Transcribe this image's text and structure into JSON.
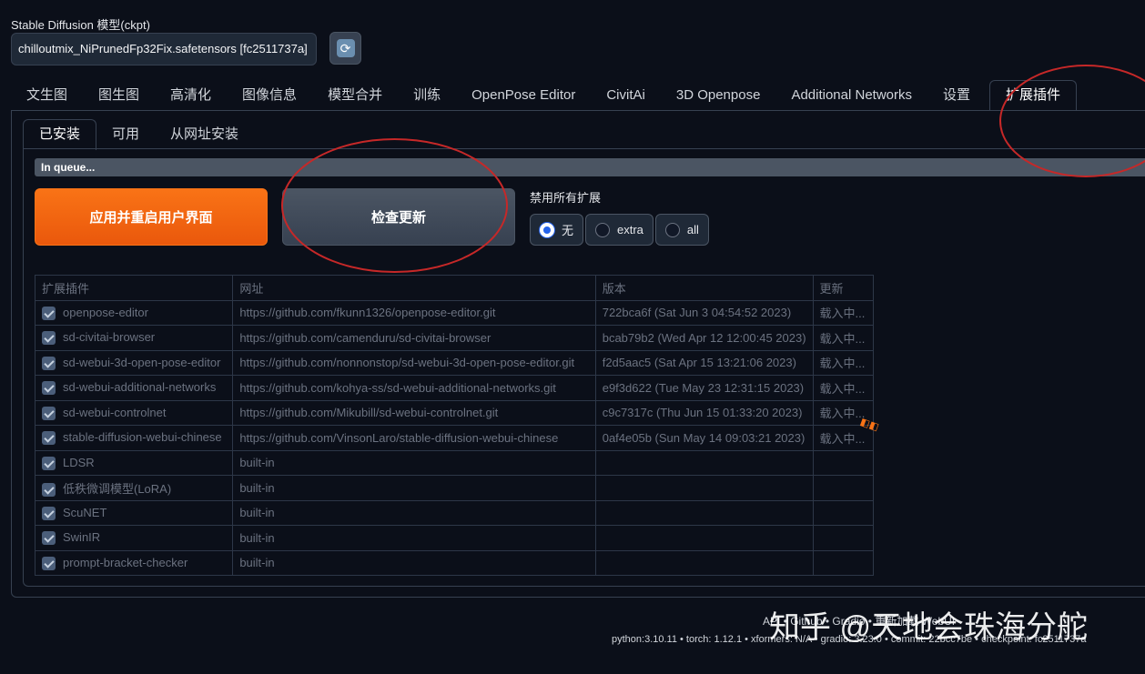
{
  "checkpoint": {
    "label": "Stable Diffusion 模型(ckpt)",
    "value": "chilloutmix_NiPrunedFp32Fix.safetensors [fc2511737a]"
  },
  "main_tabs": [
    "文生图",
    "图生图",
    "高清化",
    "图像信息",
    "模型合并",
    "训练",
    "OpenPose Editor",
    "CivitAi",
    "3D Openpose",
    "Additional Networks",
    "设置",
    "扩展插件"
  ],
  "sub_tabs": [
    "已安装",
    "可用",
    "从网址安装"
  ],
  "queue_text": "In queue...",
  "apply_button": "应用并重启用户界面",
  "check_button": "检查更新",
  "disable_label": "禁用所有扩展",
  "disable_options": [
    "无",
    "extra",
    "all"
  ],
  "table": {
    "headers": [
      "扩展插件",
      "网址",
      "版本",
      "更新"
    ],
    "rows": [
      {
        "name": "openpose-editor",
        "url": "https://github.com/fkunn1326/openpose-editor.git",
        "version": "722bca6f (Sat Jun 3 04:54:52 2023)",
        "update": "载入中..."
      },
      {
        "name": "sd-civitai-browser",
        "url": "https://github.com/camenduru/sd-civitai-browser",
        "version": "bcab79b2 (Wed Apr 12 12:00:45 2023)",
        "update": "载入中..."
      },
      {
        "name": "sd-webui-3d-open-pose-editor",
        "url": "https://github.com/nonnonstop/sd-webui-3d-open-pose-editor.git",
        "version": "f2d5aac5 (Sat Apr 15 13:21:06 2023)",
        "update": "载入中..."
      },
      {
        "name": "sd-webui-additional-networks",
        "url": "https://github.com/kohya-ss/sd-webui-additional-networks.git",
        "version": "e9f3d622 (Tue May 23 12:31:15 2023)",
        "update": "载入中..."
      },
      {
        "name": "sd-webui-controlnet",
        "url": "https://github.com/Mikubill/sd-webui-controlnet.git",
        "version": "c9c7317c (Thu Jun 15 01:33:20 2023)",
        "update": "载入中..."
      },
      {
        "name": "stable-diffusion-webui-chinese",
        "url": "https://github.com/VinsonLaro/stable-diffusion-webui-chinese",
        "version": "0af4e05b (Sun May 14 09:03:21 2023)",
        "update": "载入中..."
      },
      {
        "name": "LDSR",
        "url": "built-in",
        "version": "",
        "update": ""
      },
      {
        "name": "低秩微调模型(LoRA)",
        "url": "built-in",
        "version": "",
        "update": ""
      },
      {
        "name": "ScuNET",
        "url": "built-in",
        "version": "",
        "update": ""
      },
      {
        "name": "SwinIR",
        "url": "built-in",
        "version": "",
        "update": ""
      },
      {
        "name": "prompt-bracket-checker",
        "url": "built-in",
        "version": "",
        "update": ""
      }
    ]
  },
  "footer": {
    "links": "API  •  Github  •  Gradio  •  重新加载 WebUI",
    "info": "python:3.10.11  •  torch: 1.12.1  •  xformers: N/A  •  gradio: 3.23.0  •  commit: 22bcc7be  •  checkpoint: fc2511737a"
  },
  "watermark": "知乎 @天地会珠海分舵",
  "colors": {
    "accent_orange": "#f97316",
    "annotation_red": "#c62828",
    "background": "#0b0f19"
  }
}
